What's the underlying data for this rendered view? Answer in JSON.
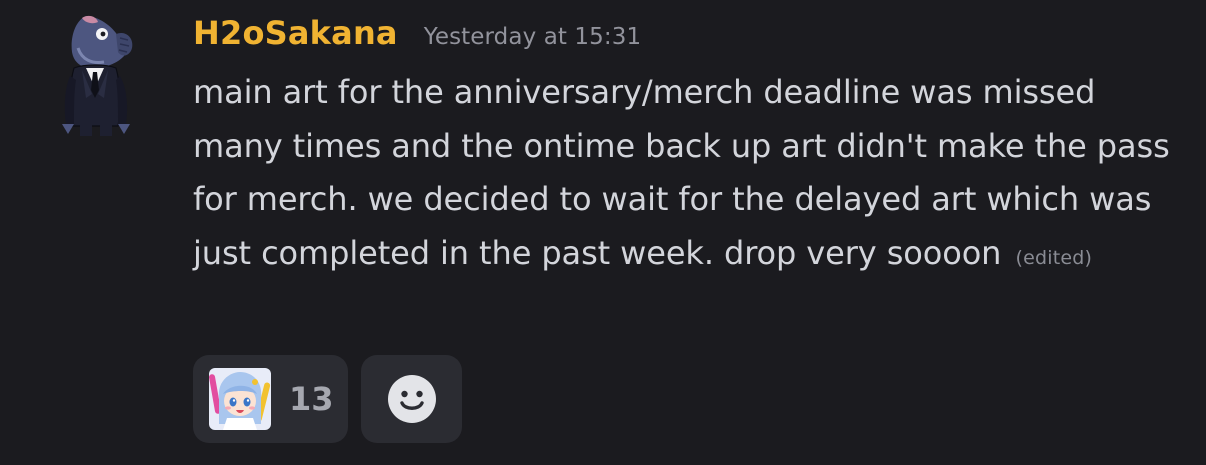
{
  "message": {
    "username": "H2oSakana",
    "timestamp": "Yesterday at 15:31",
    "content": "main art for the anniversary/merch deadline was missed many times and the ontime back up art didn't make the pass for merch. we decided to wait for the delayed art which was just completed in the past week. drop very soooon",
    "edited_label": "(edited)"
  },
  "reactions": [
    {
      "emoji": "chibi-character-emoji",
      "count": "13"
    }
  ],
  "add_reaction_icon": "smiley-face-icon",
  "colors": {
    "background": "#1b1b1f",
    "username": "#f0b332",
    "text": "#d3d5db",
    "muted": "#92939c",
    "pill": "#2b2c32"
  }
}
